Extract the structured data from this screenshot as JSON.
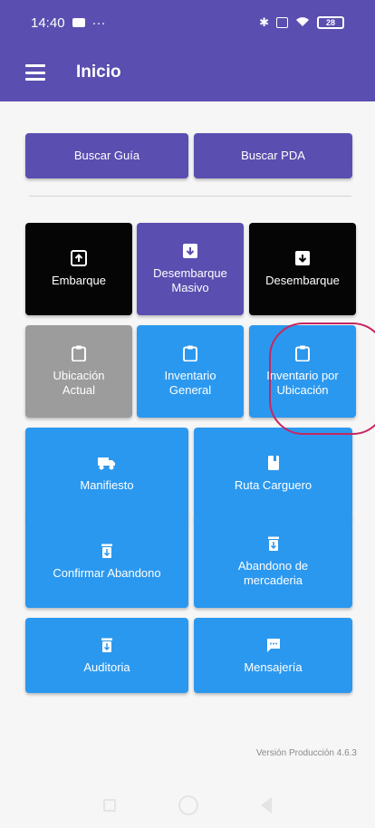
{
  "status_bar": {
    "time": "14:40",
    "left_icons_text": "···",
    "battery": "28"
  },
  "app_bar": {
    "title": "Inicio"
  },
  "search": {
    "buscar_guia": "Buscar Guía",
    "buscar_pda": "Buscar PDA"
  },
  "tiles": {
    "embarque": "Embarque",
    "desembarque_masivo": "Desembarque\nMasivo",
    "desembarque": "Desembarque",
    "ubicacion_actual": "Ubicación\nActual",
    "inventario_general": "Inventario\nGeneral",
    "inventario_por_ubicacion": "Inventario por\nUbicación",
    "manifiesto": "Manifiesto",
    "ruta_carguero": "Ruta Carguero",
    "confirmar_abandono": "Confirmar Abandono",
    "abandono_mercaderia": "Abandono de\nmercaderia",
    "auditoria": "Auditoria",
    "mensajeria": "Mensajería"
  },
  "footer": {
    "version": "Versión Producción 4.6.3"
  },
  "colors": {
    "primary": "#5a4eb0",
    "blue": "#2b98ef",
    "black": "#050505",
    "gray": "#9c9c9c",
    "highlight": "#c8265e"
  },
  "icons": {
    "upload": "upload-box-icon",
    "archive": "archive-box-icon",
    "clipboard": "clipboard-icon",
    "truck": "truck-icon",
    "book": "book-icon",
    "trash": "trash-icon",
    "chat": "chat-bubble-icon"
  }
}
